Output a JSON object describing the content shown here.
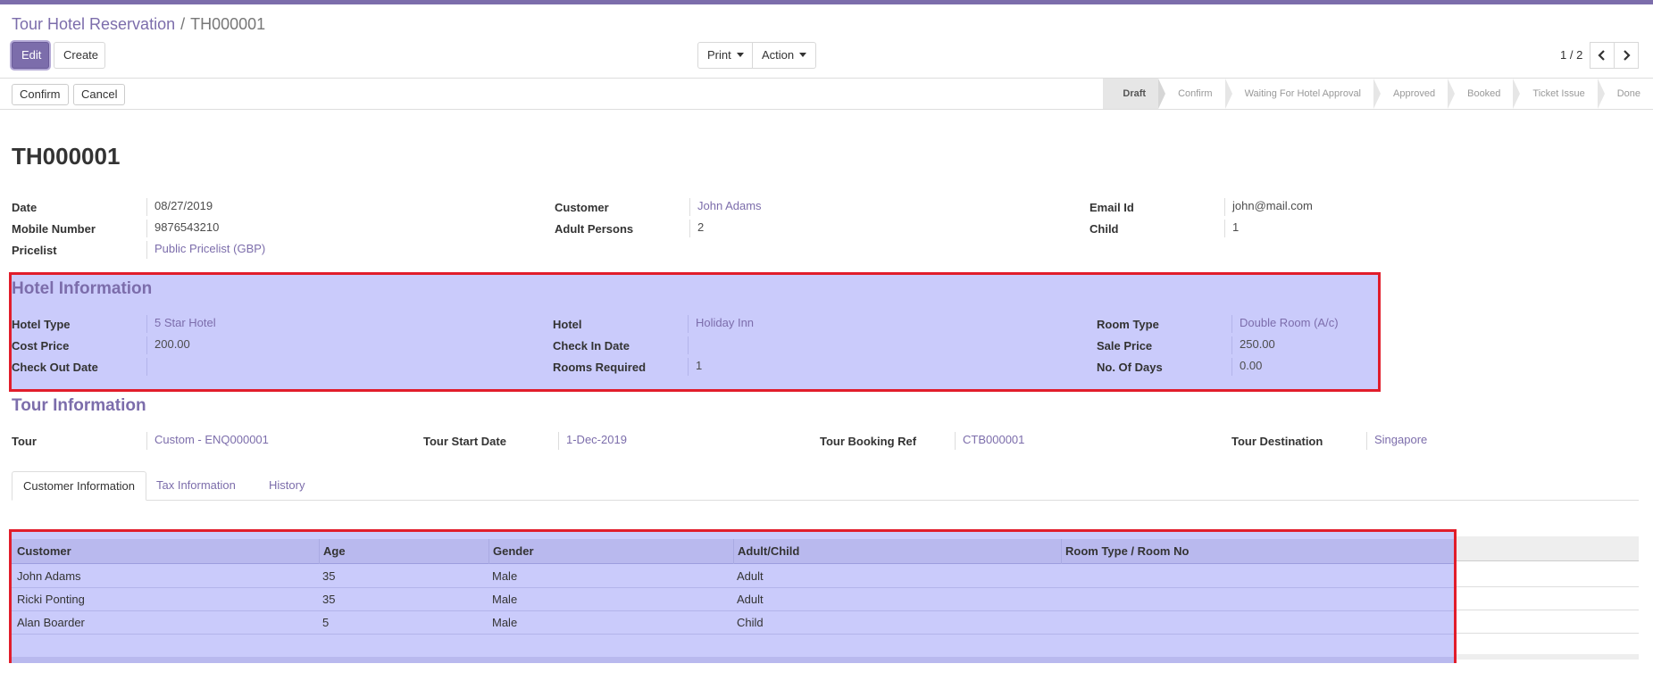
{
  "colors": {
    "brand": "#7c6dab",
    "highlight_fill": "#cacbfb",
    "highlight_border": "#e11d2b"
  },
  "breadcrumb": {
    "parent": "Tour Hotel Reservation",
    "separator": "/",
    "current": "TH000001"
  },
  "toolbar": {
    "edit_label": "Edit",
    "create_label": "Create",
    "print_label": "Print",
    "action_label": "Action"
  },
  "pager": {
    "value": "1 / 2",
    "prev_icon": "chevron-left-icon",
    "next_icon": "chevron-right-icon"
  },
  "statusbar": {
    "confirm_label": "Confirm",
    "cancel_label": "Cancel",
    "stages": [
      "Draft",
      "Confirm",
      "Waiting For Hotel Approval",
      "Approved",
      "Booked",
      "Ticket Issue",
      "Done"
    ],
    "active_stage": "Draft"
  },
  "record": {
    "title": "TH000001",
    "date_label": "Date",
    "date_value": "08/27/2019",
    "mobile_label": "Mobile Number",
    "mobile_value": "9876543210",
    "pricelist_label": "Pricelist",
    "pricelist_value": "Public Pricelist (GBP)",
    "customer_label": "Customer",
    "customer_value": "John Adams",
    "adults_label": "Adult Persons",
    "adults_value": "2",
    "email_label": "Email Id",
    "email_value": "john@mail.com",
    "child_label": "Child",
    "child_value": "1"
  },
  "hotel_info": {
    "title": "Hotel Information",
    "hotel_type_label": "Hotel Type",
    "hotel_type_value": "5 Star Hotel",
    "cost_price_label": "Cost Price",
    "cost_price_value": "200.00",
    "checkout_label": "Check Out Date",
    "checkout_value": "",
    "hotel_label": "Hotel",
    "hotel_value": "Holiday Inn",
    "checkin_label": "Check In Date",
    "checkin_value": "",
    "rooms_label": "Rooms Required",
    "rooms_value": "1",
    "room_type_label": "Room Type",
    "room_type_value": "Double Room (A/c)",
    "sale_price_label": "Sale Price",
    "sale_price_value": "250.00",
    "days_label": "No. Of Days",
    "days_value": "0.00"
  },
  "tour_info": {
    "title": "Tour Information",
    "tour_label": "Tour",
    "tour_value": "Custom - ENQ000001",
    "start_label": "Tour Start Date",
    "start_value": "1-Dec-2019",
    "booking_label": "Tour Booking Ref",
    "booking_value": "CTB000001",
    "destination_label": "Tour Destination",
    "destination_value": "Singapore"
  },
  "tabs": [
    "Customer Information",
    "Tax Information",
    "History"
  ],
  "customer_table": {
    "columns": [
      "Customer",
      "Age",
      "Gender",
      "Adult/Child",
      "Room Type / Room No"
    ],
    "rows": [
      [
        "John Adams",
        "35",
        "Male",
        "Adult",
        ""
      ],
      [
        "Ricki Ponting",
        "35",
        "Male",
        "Adult",
        ""
      ],
      [
        "Alan Boarder",
        "5",
        "Male",
        "Child",
        ""
      ]
    ]
  }
}
